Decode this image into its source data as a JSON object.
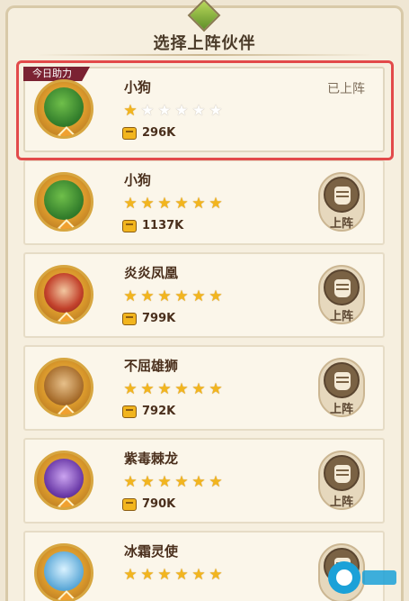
{
  "title": "选择上阵伙伴",
  "colors": {
    "accent": "#e24a4a",
    "star_on": "#f2b51e",
    "panel": "#fbf6ea"
  },
  "heroes": [
    {
      "tag": "今日助力",
      "name": "小狗",
      "stars": 1,
      "max_stars": 6,
      "power": "296K",
      "status": "已上阵",
      "portrait": "green-dragon",
      "selected": true
    },
    {
      "name": "小狗",
      "stars": 6,
      "max_stars": 6,
      "power": "1137K",
      "action": "上阵",
      "portrait": "green-dragon"
    },
    {
      "name": "炎炎凤凰",
      "stars": 6,
      "max_stars": 6,
      "power": "799K",
      "action": "上阵",
      "portrait": "red-phoenix"
    },
    {
      "name": "不屈雄狮",
      "stars": 6,
      "max_stars": 6,
      "power": "792K",
      "action": "上阵",
      "portrait": "lion"
    },
    {
      "name": "紫毒棘龙",
      "stars": 6,
      "max_stars": 6,
      "power": "790K",
      "action": "上阵",
      "portrait": "purple-dragon"
    },
    {
      "name": "冰霜灵使",
      "stars": 6,
      "max_stars": 6,
      "power": "",
      "action": "",
      "portrait": "ice-spirit"
    }
  ],
  "icons": {
    "power": "fist-icon",
    "deploy": "fist-icon",
    "header": "green-gem-icon"
  }
}
